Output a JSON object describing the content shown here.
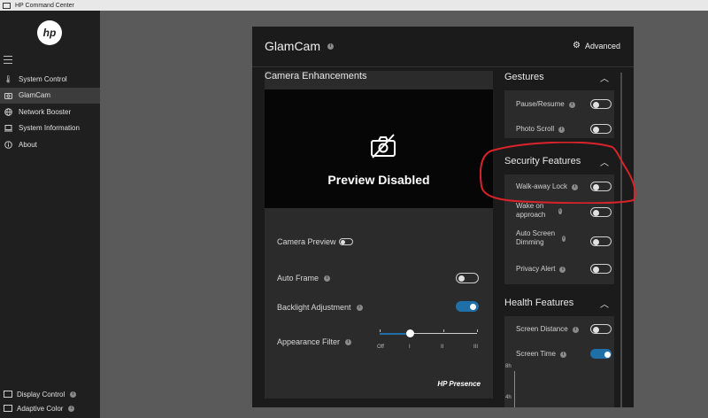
{
  "window": {
    "title": "HP Command Center"
  },
  "sidebar": {
    "logo_text": "hp",
    "items": [
      {
        "label": "System Control",
        "icon": "thermometer-icon"
      },
      {
        "label": "GlamCam",
        "icon": "camera-icon"
      },
      {
        "label": "Network Booster",
        "icon": "globe-icon"
      },
      {
        "label": "System Information",
        "icon": "laptop-icon"
      },
      {
        "label": "About",
        "icon": "info-icon"
      }
    ],
    "bottom_items": [
      {
        "label": "Display Control",
        "icon": "monitor-icon"
      },
      {
        "label": "Adaptive Color",
        "icon": "monitor-icon"
      }
    ]
  },
  "panel": {
    "title": "GlamCam",
    "advanced_label": "Advanced",
    "camera": {
      "section_title": "Camera Enhancements",
      "preview_text": "Preview Disabled",
      "camera_preview_label": "Camera Preview",
      "camera_preview_on": false,
      "auto_frame_label": "Auto Frame",
      "auto_frame_on": false,
      "backlight_label": "Backlight Adjustment",
      "backlight_on": true,
      "appearance_label": "Appearance Filter",
      "appearance_ticks": [
        "Off",
        "I",
        "II",
        "III"
      ],
      "appearance_level": 1,
      "brand_label": "HP Presence"
    },
    "gestures": {
      "title": "Gestures",
      "items": [
        {
          "label": "Pause/Resume",
          "on": false
        },
        {
          "label": "Photo Scroll",
          "on": false
        }
      ]
    },
    "security": {
      "title": "Security Features",
      "items": [
        {
          "label": "Walk-away Lock",
          "on": false
        },
        {
          "label": "Wake on approach",
          "on": false
        },
        {
          "label": "Auto Screen Dimming",
          "on": false
        },
        {
          "label": "Privacy Alert",
          "on": false
        }
      ]
    },
    "health": {
      "title": "Health Features",
      "items": [
        {
          "label": "Screen Distance",
          "on": false
        },
        {
          "label": "Screen Time",
          "on": true
        }
      ],
      "chart_labels": [
        "8h",
        "4h"
      ]
    }
  },
  "colors": {
    "accent": "#1f6fa8",
    "annotation": "#d9232a"
  }
}
